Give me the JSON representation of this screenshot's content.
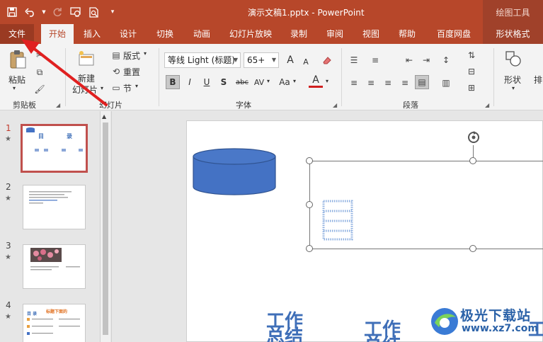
{
  "window": {
    "title": "演示文稿1.pptx  -  PowerPoint",
    "context_tab_header": "绘图工具"
  },
  "colors": {
    "accent": "#b7472a",
    "selected_thumb_border": "#c0504d",
    "shape_fill": "#4472c4",
    "annotation_arrow": "#e02020"
  },
  "quick_access": [
    {
      "icon": "save-icon"
    },
    {
      "icon": "undo-icon"
    },
    {
      "icon": "redo-icon"
    },
    {
      "icon": "from-beginning-icon"
    },
    {
      "icon": "print-preview-icon"
    },
    {
      "icon": "customize-qat-icon"
    }
  ],
  "tabs": [
    {
      "label": "文件"
    },
    {
      "label": "开始"
    },
    {
      "label": "插入"
    },
    {
      "label": "设计"
    },
    {
      "label": "切换"
    },
    {
      "label": "动画"
    },
    {
      "label": "幻灯片放映"
    },
    {
      "label": "录制"
    },
    {
      "label": "审阅"
    },
    {
      "label": "视图"
    },
    {
      "label": "帮助"
    },
    {
      "label": "百度网盘"
    },
    {
      "label": "形状格式"
    }
  ],
  "ribbon": {
    "clipboard": {
      "paste": "粘贴",
      "group": "剪贴板"
    },
    "slides": {
      "new_slide_1": "新建",
      "new_slide_2": "幻灯片",
      "layout": "版式",
      "reset": "重置",
      "section": "节",
      "group": "幻灯片"
    },
    "font": {
      "font_name": "等线 Light (标题)",
      "font_size": "65+",
      "grow": "A",
      "shrink": "A",
      "bold": "B",
      "italic": "I",
      "underline": "U",
      "shadow": "S",
      "strike": "abc",
      "spacing": "AV",
      "case": "Aa",
      "color": "A",
      "group": "字体"
    },
    "paragraph": {
      "group": "段落"
    },
    "drawing": {
      "shape": "形状",
      "arrange": "排"
    }
  },
  "thumbnails": [
    {
      "number": "1",
      "star": "★",
      "title_left": "目",
      "title_right": "录"
    },
    {
      "number": "2",
      "star": "★"
    },
    {
      "number": "3",
      "star": "★"
    },
    {
      "number": "4",
      "star": "★",
      "title": "目 录",
      "heading": "标题下面的"
    }
  ],
  "slide": {
    "text_1": "工作\n总结",
    "text_2": "工作\n总结",
    "text_3": "工"
  },
  "watermark": {
    "name": "极光下载站",
    "url": "www.xz7.com"
  }
}
